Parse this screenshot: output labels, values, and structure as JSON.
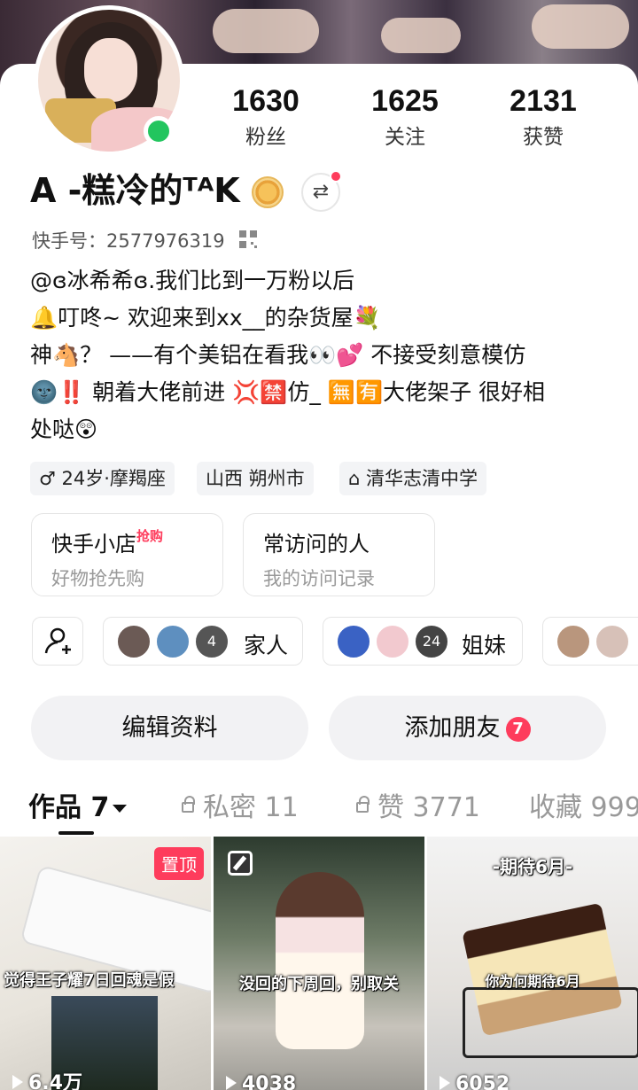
{
  "stats": [
    {
      "num": "1630",
      "label": "粉丝"
    },
    {
      "num": "1625",
      "label": "关注"
    },
    {
      "num": "2131",
      "label": "获赞"
    }
  ],
  "profile": {
    "name": "A -糕冷的ᵀᴬK",
    "kuaishou_id": "快手号：2577976319"
  },
  "bio": [
    "@ɞ冰希希ɞ.我们比到一万粉以后",
    "🔔叮咚~  欢迎来到xx__的杂货屋💐",
    "神🐴？ ——有个美铝在看我👀💕  不接受刻意模仿",
    "🌚‼️  朝着大佬前进 💢🈲仿_  🈚🈶大佬架子  很好相",
    "处哒😲"
  ],
  "tags": [
    "♂ 24岁·摩羯座",
    "山西 朔州市",
    "清华志清中学"
  ],
  "cards": [
    {
      "title": "快手小店",
      "hot": "抢购",
      "sub": "好物抢先购"
    },
    {
      "title": "常访问的人",
      "sub": "我的访问记录"
    }
  ],
  "groups": [
    {
      "label": "家人",
      "count": "4"
    },
    {
      "label": "姐妹",
      "count": "24"
    }
  ],
  "buttons": {
    "edit": "编辑资料",
    "add_friend": "添加朋友",
    "add_friend_count": "7"
  },
  "tabs": [
    {
      "label": "作品 7"
    },
    {
      "label": "私密 11"
    },
    {
      "label": "赞 3771"
    },
    {
      "label": "收藏 999"
    }
  ],
  "videos": [
    {
      "pinned": "置顶",
      "text": "觉得王子耀7日回魂是假",
      "plays": "6.4万"
    },
    {
      "text": "没回的下周回，别取关",
      "plays": "4038"
    },
    {
      "top_text": "-期待6月-",
      "text": "你为何期待6月",
      "plays": "6052"
    }
  ]
}
